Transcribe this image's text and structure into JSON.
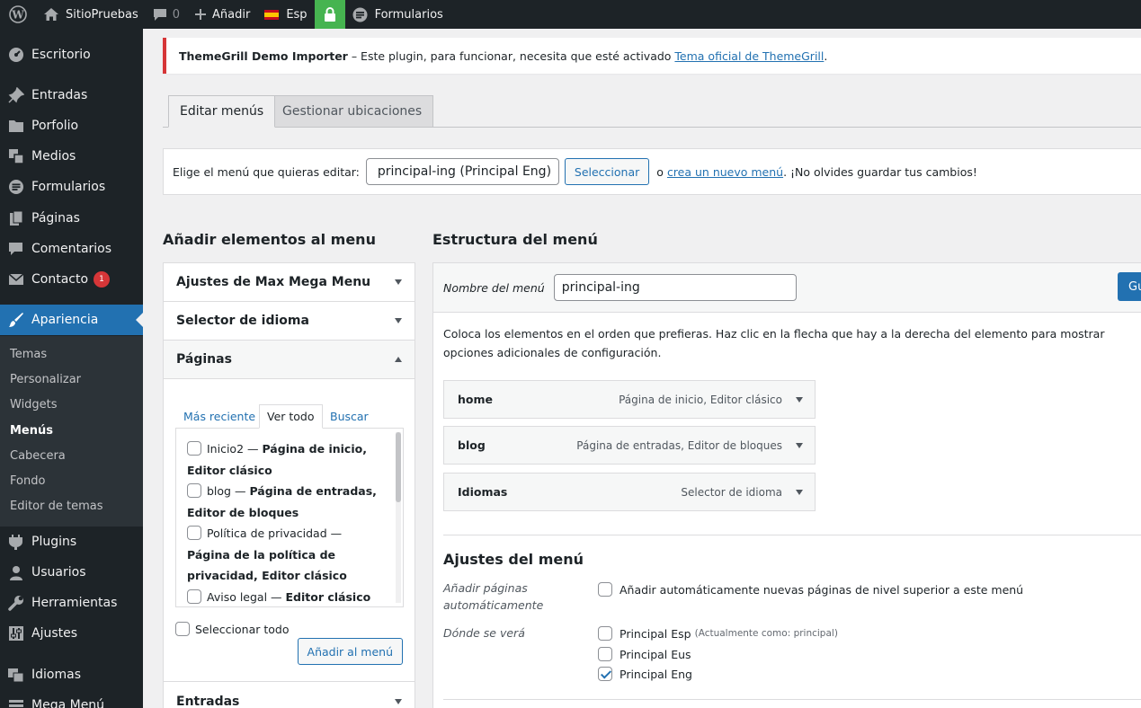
{
  "adminbar": {
    "site_name": "SitioPruebas",
    "comments_count": "0",
    "add_label": "Añadir",
    "language_label": "Esp",
    "forms_label": "Formularios"
  },
  "sidebar": {
    "items": [
      {
        "label": "Escritorio",
        "icon": "dashboard-icon"
      },
      {
        "label": "Entradas",
        "icon": "pin-icon"
      },
      {
        "label": "Porfolio",
        "icon": "folder-icon"
      },
      {
        "label": "Medios",
        "icon": "media-icon"
      },
      {
        "label": "Formularios",
        "icon": "forms-icon"
      },
      {
        "label": "Páginas",
        "icon": "pages-icon"
      },
      {
        "label": "Comentarios",
        "icon": "comment-icon"
      },
      {
        "label": "Contacto",
        "icon": "mail-icon",
        "badge": "1"
      },
      {
        "label": "Apariencia",
        "icon": "brush-icon"
      },
      {
        "label": "Plugins",
        "icon": "plugin-icon"
      },
      {
        "label": "Usuarios",
        "icon": "users-icon"
      },
      {
        "label": "Herramientas",
        "icon": "wrench-icon"
      },
      {
        "label": "Ajustes",
        "icon": "settings-icon"
      },
      {
        "label": "Idiomas",
        "icon": "translate-icon"
      },
      {
        "label": "Mega Menú",
        "icon": "megamenu-icon"
      }
    ],
    "submenu": [
      "Temas",
      "Personalizar",
      "Widgets",
      "Menús",
      "Cabecera",
      "Fondo",
      "Editor de temas"
    ]
  },
  "notice": {
    "plugin": "ThemeGrill Demo Importer",
    "text": " – Este plugin, para funcionar, necesita que esté activado ",
    "link": "Tema oficial de ThemeGrill",
    "end": "."
  },
  "tabs": {
    "edit": "Editar menús",
    "locations": "Gestionar ubicaciones"
  },
  "menubar": {
    "label": "Elige el menú que quieras editar:",
    "selected": "principal-ing (Principal Eng)",
    "select_button": "Seleccionar",
    "or": "o",
    "create_link": "crea un nuevo menú",
    "reminder": ". ¡No olvides guardar tus cambios!"
  },
  "left": {
    "title": "Añadir elementos al menu",
    "sections": [
      "Ajustes de Max Mega Menu",
      "Selector de idioma",
      "Páginas",
      "Entradas"
    ],
    "page_tabs": [
      "Más reciente",
      "Ver todo",
      "Buscar"
    ],
    "pages": [
      {
        "name": "Inicio2 — ",
        "desc": "Página de inicio, Editor clásico"
      },
      {
        "name": "blog — ",
        "desc": "Página de entradas, Editor de bloques"
      },
      {
        "name": "Política de privacidad — ",
        "desc": "Página de la política de privacidad, Editor clásico"
      },
      {
        "name": "Aviso legal — ",
        "desc": "Editor clásico"
      }
    ],
    "select_all": "Seleccionar todo",
    "add_button": "Añadir al menú"
  },
  "structure": {
    "title": "Estructura del menú",
    "name_label": "Nombre del menú",
    "name_value": "principal-ing",
    "save_button": "Gu",
    "instructions": "Coloca los elementos en el orden que prefieras. Haz clic en la flecha que hay a la derecha del elemento para mostrar opciones adicionales de configuración.",
    "items": [
      {
        "title": "home",
        "meta": "Página de inicio, Editor clásico"
      },
      {
        "title": "blog",
        "meta": "Página de entradas, Editor de bloques"
      },
      {
        "title": "Idiomas",
        "meta": "Selector de idioma"
      }
    ],
    "settings_title": "Ajustes del menú",
    "auto_label": "Añadir páginas automáticamente",
    "auto_option": "Añadir automáticamente nuevas páginas de nivel superior a este menú",
    "where_label": "Dónde se verá",
    "locations": [
      {
        "label": "Principal Esp",
        "note": "(Actualmente como: principal)",
        "checked": false
      },
      {
        "label": "Principal Eus",
        "note": "",
        "checked": false
      },
      {
        "label": "Principal Eng",
        "note": "",
        "checked": true
      }
    ]
  },
  "colors": {
    "accent": "#2271b1",
    "sidebar": "#1d2327",
    "notice_border": "#d63638",
    "lock": "#46b450"
  }
}
